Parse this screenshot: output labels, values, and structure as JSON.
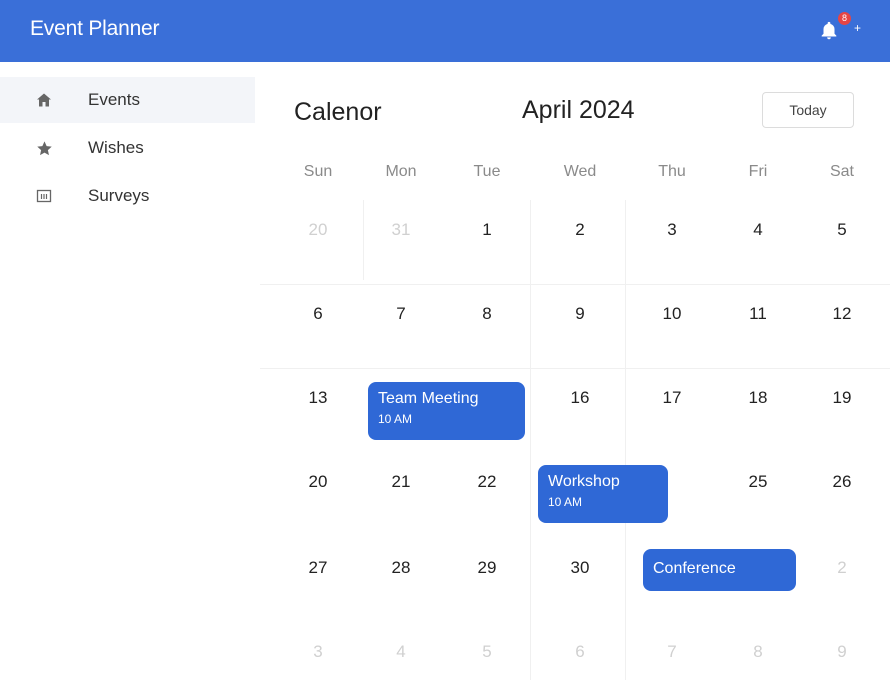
{
  "app": {
    "title": "Event Planner",
    "notification_count": "8",
    "accent": "#3a6fd8"
  },
  "sidebar": {
    "items": [
      {
        "label": "Events",
        "icon": "home-icon",
        "active": true
      },
      {
        "label": "Wishes",
        "icon": "star-icon",
        "active": false
      },
      {
        "label": "Surveys",
        "icon": "survey-icon",
        "active": false
      }
    ]
  },
  "calendar": {
    "title": "Calenor",
    "month": "April 2024",
    "today_label": "Today",
    "weekdays": [
      "Sun",
      "Mon",
      "Tue",
      "Wed",
      "Thu",
      "Fri",
      "Sat"
    ],
    "weeks": [
      [
        "20",
        "31",
        "1",
        "2",
        "3",
        "4",
        "5"
      ],
      [
        "6",
        "7",
        "8",
        "9",
        "10",
        "11",
        "12"
      ],
      [
        "13",
        "",
        "",
        "16",
        "17",
        "18",
        "19"
      ],
      [
        "20",
        "21",
        "22",
        "",
        "",
        "25",
        "26"
      ],
      [
        "27",
        "28",
        "29",
        "30",
        "",
        "",
        "2"
      ],
      [
        "3",
        "4",
        "5",
        "6",
        "7",
        "8",
        "9"
      ]
    ],
    "events": [
      {
        "title": "Team Meeting",
        "time": "10 AM"
      },
      {
        "title": "Workshop",
        "time": "10 AM"
      },
      {
        "title": "Conference",
        "time": ""
      }
    ]
  }
}
